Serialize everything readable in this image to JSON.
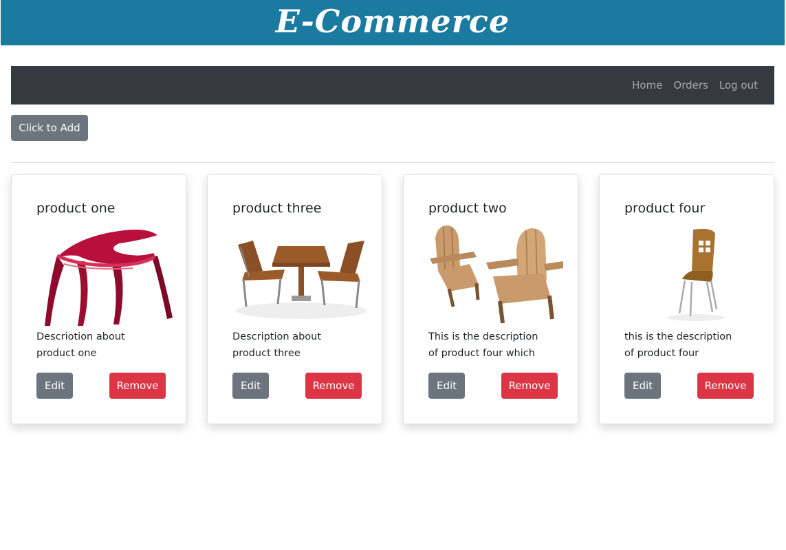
{
  "header": {
    "title": "E-Commerce"
  },
  "nav": {
    "home": "Home",
    "orders": "Orders",
    "logout": "Log out"
  },
  "actions": {
    "add_label": "Click to Add"
  },
  "products": [
    {
      "title": "product one",
      "description": "Descriotion about product one",
      "image": "red-modern-chair-image",
      "edit_label": "Edit",
      "remove_label": "Remove"
    },
    {
      "title": "product three",
      "description": "Description about product three",
      "image": "patio-table-chairs-image",
      "edit_label": "Edit",
      "remove_label": "Remove"
    },
    {
      "title": "product two",
      "description": "This is the description of product four which is the",
      "image": "adirondack-chairs-image",
      "edit_label": "Edit",
      "remove_label": "Remove"
    },
    {
      "title": "product four",
      "description": "this is the description of product four",
      "image": "wooden-cafe-chair-image",
      "edit_label": "Edit",
      "remove_label": "Remove"
    }
  ],
  "colors": {
    "banner": "#1a7aa0",
    "navbar": "#343a40",
    "secondary": "#6c757d",
    "danger": "#dc3545"
  }
}
